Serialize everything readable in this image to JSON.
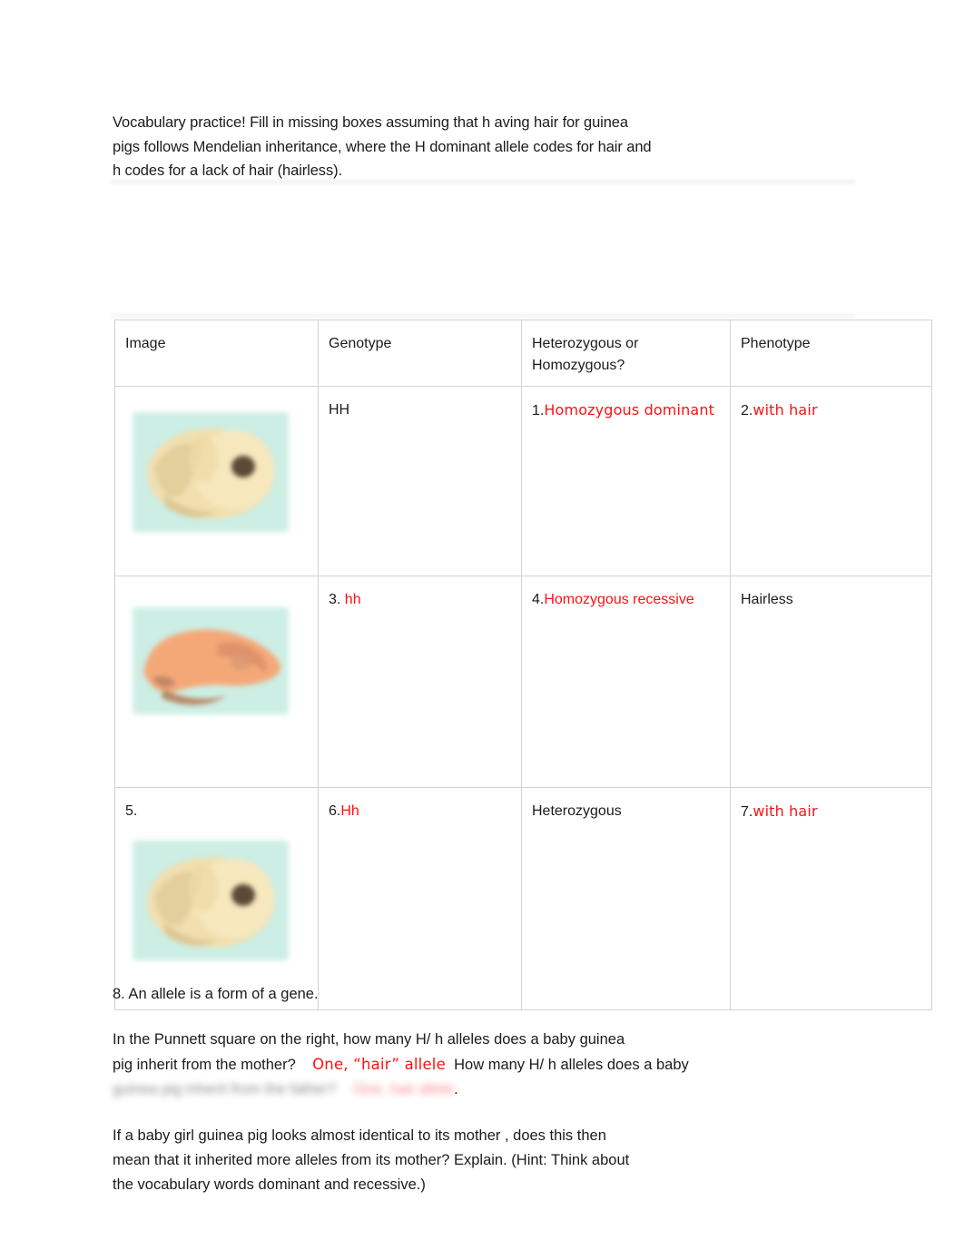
{
  "document": {
    "intro_lines": [
      "Vocabulary practice! Fill in missing boxes assuming that h aving hair for guinea",
      "pigs follows Mendelian inheritance, where the H dominant allele codes for hair and",
      "h codes for a lack of hair (hairless)."
    ]
  },
  "table": {
    "headers": [
      "Image",
      "Genotype",
      "Heterozygous or\nHomozygous?",
      "Phenotype"
    ],
    "rows": [
      {
        "image_label": "",
        "image_alt": "cream-guinea-pig-with-hair",
        "genotype_num": "",
        "genotype": "HH",
        "zygosity_num": "1.",
        "zygosity": "Homozygous dominant",
        "zygosity_style": "round-red",
        "phenotype_num": "2.",
        "phenotype": "with hair",
        "phenotype_style": "round-red"
      },
      {
        "image_label": "",
        "image_alt": "salmon-hairless-guinea-pig",
        "genotype_num": "3.",
        "genotype": "hh",
        "genotype_style": "plain-red",
        "zygosity_num": "4.",
        "zygosity": "Homozygous recessive",
        "zygosity_style": "plain-red",
        "phenotype_num": "",
        "phenotype": "Hairless",
        "phenotype_style": "black"
      },
      {
        "image_label": "5.",
        "image_alt": "cream-guinea-pig-with-hair",
        "genotype_num": "6.",
        "genotype": "Hh",
        "genotype_style": "plain-red",
        "zygosity_num": "",
        "zygosity": "Heterozygous",
        "zygosity_style": "black",
        "phenotype_num": "7.",
        "phenotype": "with hair",
        "phenotype_style": "round-red"
      }
    ]
  },
  "questions": {
    "q8": "8. An allele is a form of a gene.",
    "q9_part1": "In the Punnett square on the right, how many H/ h alleles does a baby guinea",
    "q9_part2": "pig inherit from the mother?",
    "q9_answer": "One, “hair” allele",
    "q9_part3": "How many H/ h alleles does a baby",
    "q9_blurred_black": "guinea pig inherit from the father?",
    "q9_blurred_red": "One, hair allele",
    "q9_period": ".",
    "q10_lines": [
      "If a baby girl guinea pig looks almost identical to its mother , does this then",
      "mean that it inherited more alleles from its mother? Explain. (Hint: Think about",
      "the vocabulary words dominant and recessive.)"
    ]
  },
  "colors": {
    "annotation_red": "#fc1212",
    "body_text": "#1b1b1b",
    "table_border": "#d2d2d2",
    "image_background_mint": "#cdeee4",
    "guinea_pig_cream": "#f3e2b4",
    "guinea_pig_tan_shadow": "#d6c18e",
    "guinea_pig_salmon": "#f4a878",
    "guinea_pig_salmon_shadow": "#c98860",
    "eye_dark": "#4a3f33",
    "page_background": "#ffffff"
  }
}
